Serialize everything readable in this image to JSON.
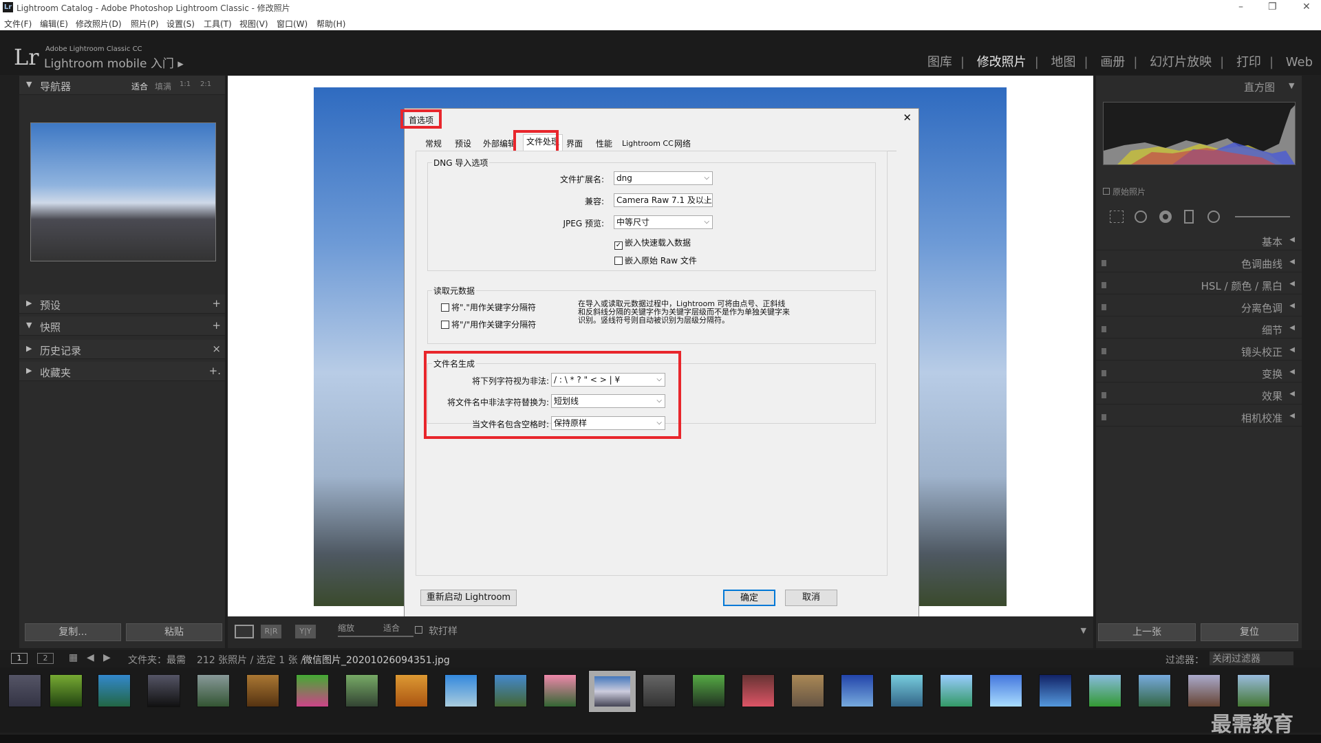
{
  "window": {
    "title": "Lightroom Catalog - Adobe Photoshop Lightroom Classic - 修改照片",
    "app_icon": "Lr",
    "minimize": "–",
    "restore": "❐",
    "close": "✕"
  },
  "menu": [
    "文件(F)",
    "编辑(E)",
    "修改照片(D)",
    "照片(P)",
    "设置(S)",
    "工具(T)",
    "视图(V)",
    "窗口(W)",
    "帮助(H)"
  ],
  "brand": {
    "logo": "Lr",
    "line1": "Adobe Lightroom Classic CC",
    "line2": "Lightroom mobile 入门 ▸"
  },
  "modules": [
    "图库",
    "修改照片",
    "地图",
    "画册",
    "幻灯片放映",
    "打印",
    "Web"
  ],
  "left_panel": {
    "navigator": {
      "label": "导航器",
      "zoom": [
        "适合",
        "填满",
        "1:1",
        "2:1"
      ]
    },
    "sections": [
      {
        "label": "预设",
        "action": "+"
      },
      {
        "label": "快照",
        "action": "+"
      },
      {
        "label": "历史记录",
        "action": "×"
      },
      {
        "label": "收藏夹",
        "action": "+."
      }
    ],
    "copy": "复制...",
    "paste": "粘贴"
  },
  "dialog": {
    "title": "首选项",
    "close": "✕",
    "tabs": [
      "常规",
      "预设",
      "外部编辑",
      "文件处理",
      "界面",
      "性能",
      "Lightroom CC",
      "网络"
    ],
    "dng": {
      "group": "DNG 导入选项",
      "ext_label": "文件扩展名:",
      "ext_value": "dng",
      "compat_label": "兼容:",
      "compat_value": "Camera Raw 7.1 及以上",
      "jpeg_label": "JPEG 预览:",
      "jpeg_value": "中等尺寸",
      "embed_fast": "嵌入快速载入数据",
      "embed_raw": "嵌入原始 Raw 文件"
    },
    "metadata": {
      "group": "读取元数据",
      "opt1": "将\".\"用作关键字分隔符",
      "opt2": "将\"/\"用作关键字分隔符",
      "desc": "在导入或读取元数据过程中，Lightroom 可将由点号、正斜线和反斜线分隔的关键字作为关键字层级而不是作为单独关键字来识别。竖线符号则自动被识别为层级分隔符。"
    },
    "filename": {
      "group": "文件名生成",
      "illegal_label": "将下列字符视为非法:",
      "illegal_value": "/ : \\ * ? \" < > | ¥",
      "replace_label": "将文件名中非法字符替换为:",
      "replace_value": "短划线",
      "space_label": "当文件名包含空格时:",
      "space_value": "保持原样"
    },
    "restart": "重新启动 Lightroom",
    "ok": "确定",
    "cancel": "取消"
  },
  "right_panel": {
    "histogram": "直方图",
    "original": "原始照片",
    "sections": [
      "基本",
      "色调曲线",
      "HSL / 颜色 / 黑白",
      "分离色调",
      "细节",
      "镜头校正",
      "变换",
      "效果",
      "相机校准"
    ],
    "prev": "上一张",
    "reset": "复位"
  },
  "toolbar": {
    "zoom": "缩放",
    "fit": "适合",
    "softproof": "软打样"
  },
  "filmstrip": {
    "page1": "1",
    "page2": "2",
    "path": "文件夹：最需",
    "count": "212 张照片 / 选定 1 张 /",
    "file": "微信图片_20201026094351.jpg",
    "filter_label": "过滤器：",
    "filter_value": "关闭过滤器"
  },
  "watermark": "最需教育",
  "colors": {
    "highlight": "#e8262c"
  }
}
